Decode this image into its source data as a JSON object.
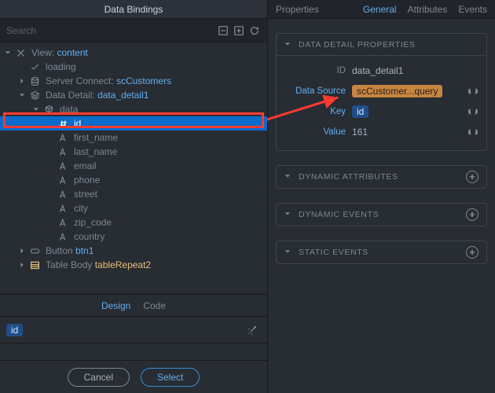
{
  "left_panel": {
    "title": "Data Bindings",
    "search_placeholder": "Search",
    "tree": {
      "view_label": "View:",
      "view_name": "content",
      "loading": "loading",
      "server_connect_label": "Server Connect:",
      "server_connect_name": "scCustomers",
      "data_detail_label": "Data Detail:",
      "data_detail_name": "data_detail1",
      "data": "data",
      "fields": {
        "id": "id",
        "first_name": "first_name",
        "last_name": "last_name",
        "email": "email",
        "phone": "phone",
        "street": "street",
        "city": "city",
        "zip_code": "zip_code",
        "country": "country"
      },
      "button_label": "Button",
      "button_name": "btn1",
      "table_body_label": "Table Body",
      "table_body_name": "tableRepeat2"
    },
    "design_tab": "Design",
    "code_tab": "Code",
    "value_chip": "id",
    "cancel": "Cancel",
    "select": "Select"
  },
  "right_panel": {
    "title": "Properties",
    "tabs": {
      "general": "General",
      "attributes": "Attributes",
      "events": "Events"
    },
    "section1": {
      "title": "DATA DETAIL PROPERTIES",
      "id_label": "ID",
      "id_value": "data_detail1",
      "ds_label": "Data Source",
      "ds_value": "scCustomer...query",
      "key_label": "Key",
      "key_value": "id",
      "value_label": "Value",
      "value_value": "161"
    },
    "section2": "DYNAMIC ATTRIBUTES",
    "section3": "DYNAMIC EVENTS",
    "section4": "STATIC EVENTS"
  }
}
